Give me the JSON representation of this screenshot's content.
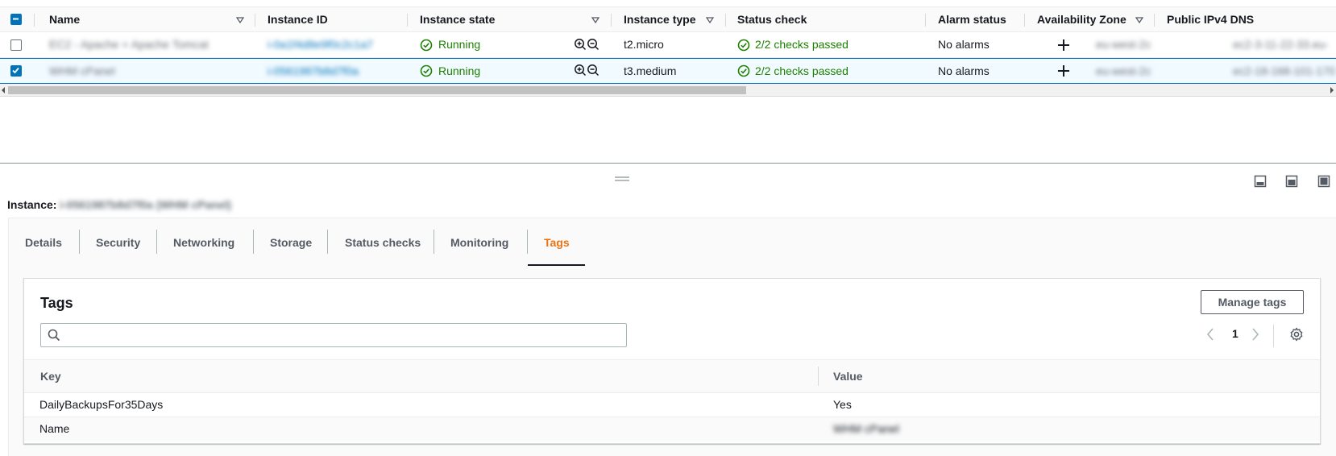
{
  "table": {
    "columns": {
      "name": "Name",
      "instance_id": "Instance ID",
      "instance_state": "Instance state",
      "instance_type": "Instance type",
      "status_check": "Status check",
      "alarm_status": "Alarm status",
      "availability_zone": "Availability Zone",
      "public_dns": "Public IPv4 DNS"
    },
    "rows": [
      {
        "name": "EC2 - Apache + Apache Tomcat",
        "instance_id": "i-0a1f4d8e9f0c2c1a7",
        "state": "Running",
        "type": "t2.micro",
        "status": "2/2 checks passed",
        "alarm": "No alarms",
        "zone": "eu-west-2c",
        "dns": "ec2-3-11-22-33.eu-"
      },
      {
        "name": "WHM cPanel",
        "instance_id": "i-0561987b8d7f0a",
        "state": "Running",
        "type": "t3.medium",
        "status": "2/2 checks passed",
        "alarm": "No alarms",
        "zone": "eu-west-2c",
        "dns": "ec2-18-168-101-170"
      }
    ]
  },
  "detail": {
    "instance_label": "Instance:",
    "instance_value": "i-0561987b8d7f0a (WHM cPanel)",
    "tabs": [
      "Details",
      "Security",
      "Networking",
      "Storage",
      "Status checks",
      "Monitoring",
      "Tags"
    ],
    "active_tab": "Tags"
  },
  "tags": {
    "title": "Tags",
    "manage_label": "Manage tags",
    "search_placeholder": "",
    "page": "1",
    "headers": {
      "key": "Key",
      "value": "Value"
    },
    "rows": [
      {
        "key": "DailyBackupsFor35Days",
        "value": "Yes"
      },
      {
        "key": "Name",
        "value": "WHM cPanel"
      }
    ]
  },
  "colors": {
    "accent": "#0073bb",
    "active_tab": "#ec7211",
    "success": "#1d8102"
  },
  "icons": [
    "select-all-checkbox",
    "sort-icon",
    "check-circle-icon",
    "zoom-in-icon",
    "zoom-out-icon",
    "plus-icon",
    "drag-handle-icon",
    "panel-layout-icon",
    "search-icon",
    "chevron-left-icon",
    "chevron-right-icon",
    "gear-icon"
  ]
}
